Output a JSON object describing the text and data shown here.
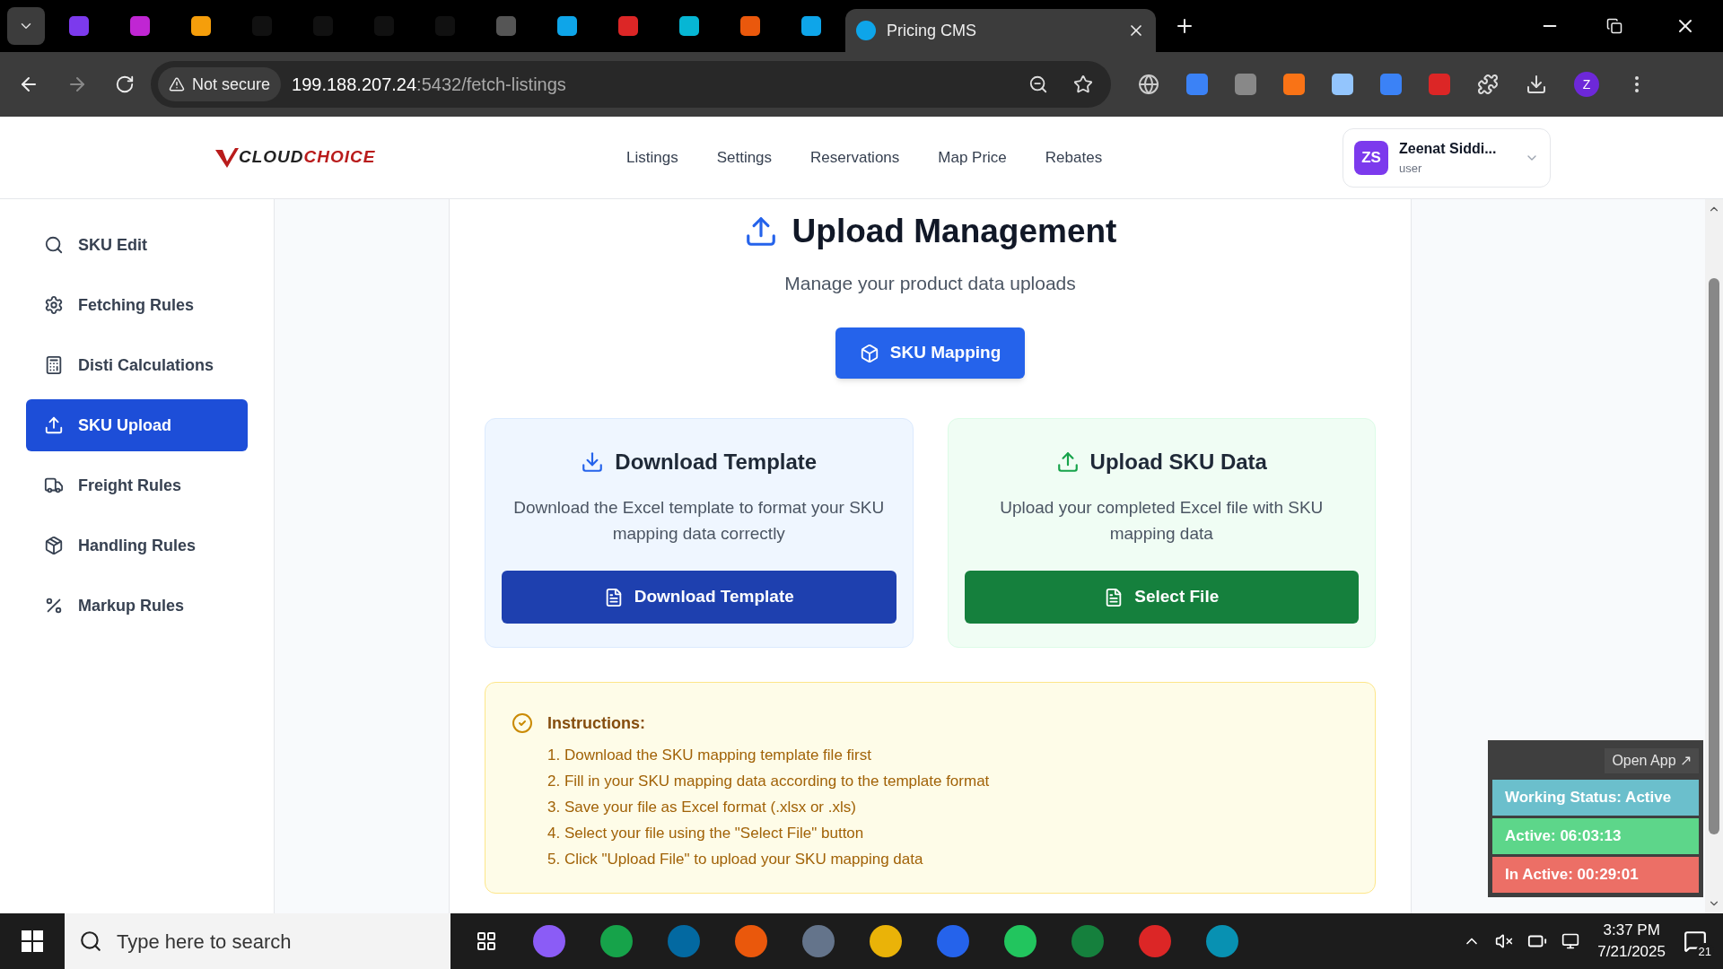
{
  "browser": {
    "active_tab": {
      "title": "Pricing CMS"
    },
    "security_label": "Not secure",
    "url_host": "199.188.207.24",
    "url_path": ":5432/fetch-listings",
    "profile_initial": "Z"
  },
  "header": {
    "logo": {
      "part1": "CLOUD",
      "part2": "CHOICE"
    },
    "nav": [
      {
        "label": "Listings",
        "selected": false
      },
      {
        "label": "Settings",
        "selected": false
      },
      {
        "label": "Reservations",
        "selected": false
      },
      {
        "label": "Map Price",
        "selected": false
      },
      {
        "label": "Rebates",
        "selected": false
      }
    ],
    "user": {
      "initials": "ZS",
      "name": "Zeenat Siddi...",
      "role": "user"
    }
  },
  "sidebar": {
    "items": [
      {
        "label": "SKU Edit",
        "selected": false
      },
      {
        "label": "Fetching Rules",
        "selected": false
      },
      {
        "label": "Disti Calculations",
        "selected": false
      },
      {
        "label": "SKU Upload",
        "selected": true
      },
      {
        "label": "Freight Rules",
        "selected": false
      },
      {
        "label": "Handling Rules",
        "selected": false
      },
      {
        "label": "Markup Rules",
        "selected": false
      }
    ]
  },
  "main": {
    "title": "Upload Management",
    "subtitle": "Manage your product data uploads",
    "mapping_button": "SKU Mapping",
    "cards": [
      {
        "kind": "download",
        "title": "Download Template",
        "description": "Download the Excel template to format your SKU mapping data correctly",
        "button": "Download Template"
      },
      {
        "kind": "upload",
        "title": "Upload SKU Data",
        "description": "Upload your completed Excel file with SKU mapping data",
        "button": "Select File"
      }
    ],
    "instructions": {
      "title": "Instructions:",
      "steps": [
        "1. Download the SKU mapping template file first",
        "2. Fill in your SKU mapping data according to the template format",
        "3. Save your file as Excel format (.xlsx or .xls)",
        "4. Select your file using the \"Select File\" button",
        "5. Click \"Upload File\" to upload your SKU mapping data"
      ]
    }
  },
  "status_widget": {
    "open_app": "Open App ↗",
    "rows": [
      {
        "text": "Working Status: Active",
        "color": "#6bbfcc"
      },
      {
        "text": "Active: 06:03:13",
        "color": "#5dd68a"
      },
      {
        "text": "In Active: 00:29:01",
        "color": "#ec6f66"
      }
    ]
  },
  "taskbar": {
    "search_placeholder": "Type here to search",
    "time": "3:37 PM",
    "date": "7/21/2025",
    "notifications": "21"
  }
}
